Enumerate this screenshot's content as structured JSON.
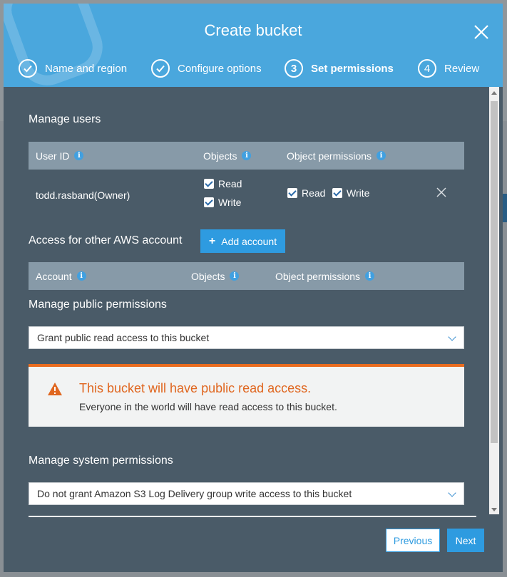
{
  "modal": {
    "title": "Create bucket",
    "steps": [
      {
        "number": "1",
        "label": "Name and region",
        "state": "done"
      },
      {
        "number": "2",
        "label": "Configure options",
        "state": "done"
      },
      {
        "number": "3",
        "label": "Set permissions",
        "state": "active"
      },
      {
        "number": "4",
        "label": "Review",
        "state": "pending"
      }
    ]
  },
  "manage_users": {
    "title": "Manage users",
    "columns": {
      "user_id": "User ID",
      "objects": "Objects",
      "object_permissions": "Object permissions"
    },
    "row": {
      "user": "todd.rasband(Owner)",
      "objects": {
        "read": "Read",
        "write": "Write"
      },
      "object_permissions": {
        "read": "Read",
        "write": "Write"
      }
    }
  },
  "other_accounts": {
    "title": "Access for other AWS account",
    "add_label": "Add account",
    "columns": {
      "account": "Account",
      "objects": "Objects",
      "object_permissions": "Object permissions"
    }
  },
  "public_permissions": {
    "title": "Manage public permissions",
    "selected": "Grant public read access to this bucket",
    "warning_title": "This bucket will have public read access.",
    "warning_text": "Everyone in the world will have read access to this bucket."
  },
  "system_permissions": {
    "title": "Manage system permissions",
    "selected": "Do not grant Amazon S3 Log Delivery group write access to this bucket"
  },
  "footer": {
    "previous": "Previous",
    "next": "Next"
  },
  "colors": {
    "header": "#4aa7dd",
    "body": "#4a5b68",
    "accent": "#2e9be0",
    "warning": "#ea6c1f"
  }
}
